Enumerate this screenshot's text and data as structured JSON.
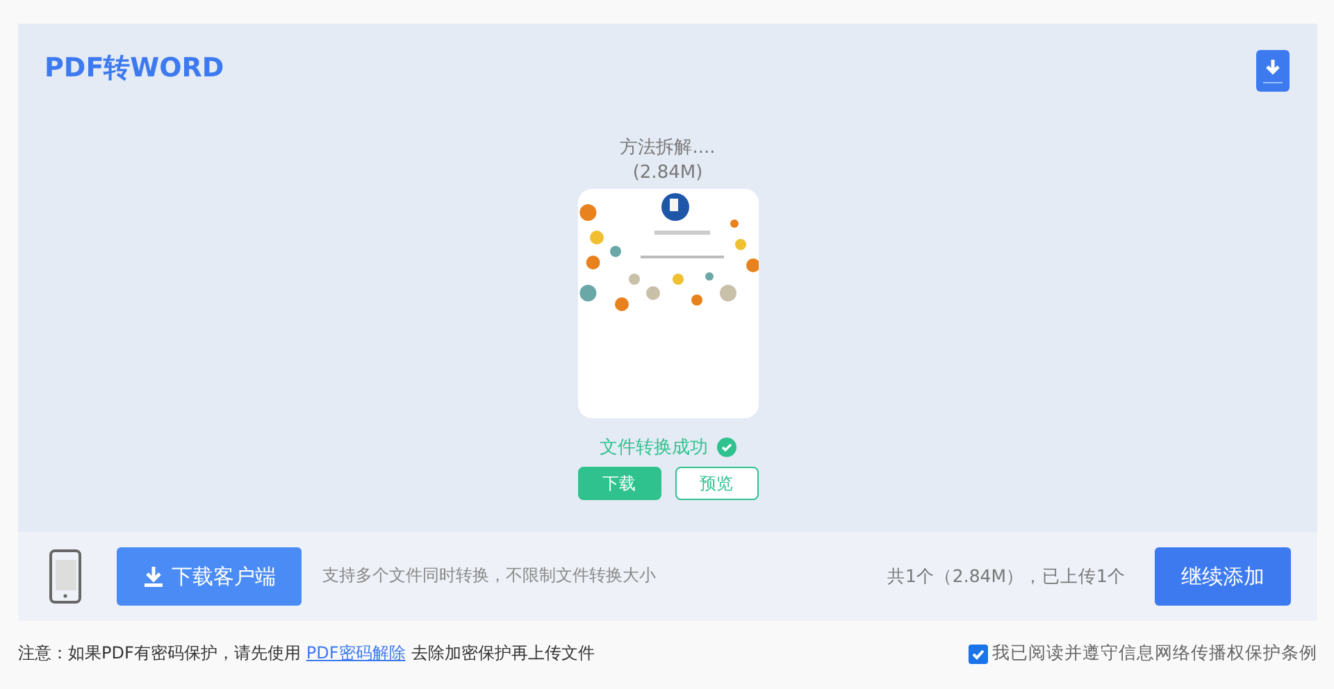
{
  "header": {
    "title": "PDF转WORD"
  },
  "file": {
    "name": "方法拆解....",
    "size": "(2.84M)",
    "status": "文件转换成功",
    "converted": true,
    "actions": [
      {
        "label": "下载",
        "kind": "primary"
      },
      {
        "label": "预览",
        "kind": "outline"
      }
    ]
  },
  "bottom_bar": {
    "client_button": "下载客户端",
    "hint": "支持多个文件同时转换，不限制文件转换大小",
    "summary": "共1个（2.84M），已上传1个",
    "add_button": "继续添加"
  },
  "notice": {
    "before": "注意：如果PDF有密码保护，请先使用",
    "link": "PDF密码解除",
    "after": "去除加密保护再上传文件"
  },
  "agreement": {
    "label": "我已阅读并遵守信息网络传播权保护条例",
    "checked": true
  }
}
